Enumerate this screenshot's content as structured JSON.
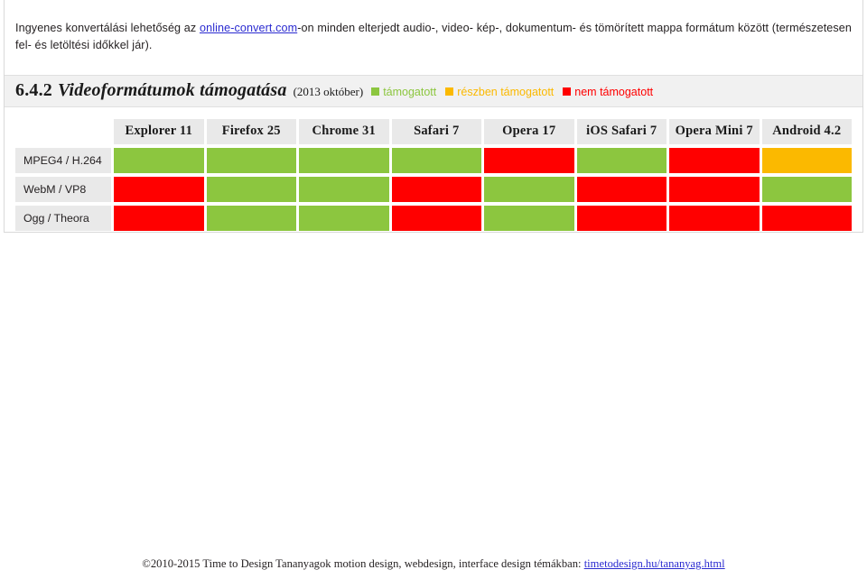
{
  "intro": {
    "before_link": "Ingyenes konvertálási lehetőség az ",
    "link_text": "online-convert.com",
    "after_link": "-on minden elterjedt audio-, video- kép-, dokumentum- és tömörített mappa formátum között (természetesen fel- és letöltési időkkel jár)."
  },
  "section": {
    "number": "6.4.2",
    "title": "Videoformátumok támogatása",
    "date": "(2013 október)"
  },
  "legend": [
    {
      "label": "támogatott",
      "color": "#8cc63f"
    },
    {
      "label": "részben támogatott",
      "color": "#fbb900"
    },
    {
      "label": "nem támogatott",
      "color": "#ff0000"
    }
  ],
  "table": {
    "corner_label": "",
    "columns": [
      "Explorer 11",
      "Firefox 25",
      "Chrome 31",
      "Safari 7",
      "Opera 17",
      "iOS Safari 7",
      "Opera Mini 7",
      "Android 4.2"
    ],
    "rows": [
      {
        "label": "MPEG4 / H.264",
        "values": [
          "yes",
          "yes",
          "yes",
          "yes",
          "no",
          "yes",
          "no",
          "partial"
        ]
      },
      {
        "label": "WebM / VP8",
        "values": [
          "no",
          "yes",
          "yes",
          "no",
          "yes",
          "no",
          "no",
          "yes"
        ]
      },
      {
        "label": "Ogg / Theora",
        "values": [
          "no",
          "yes",
          "yes",
          "no",
          "yes",
          "no",
          "no",
          "no"
        ]
      }
    ]
  },
  "footer": {
    "text": "©2010-2015 Time to Design Tananyagok motion design, webdesign, interface design témákban: ",
    "link_text": "timetodesign.hu/tananyag.html"
  }
}
